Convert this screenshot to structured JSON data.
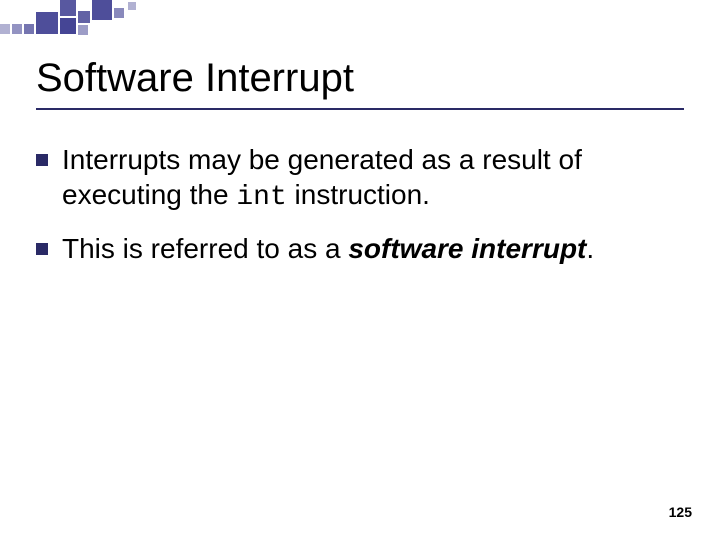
{
  "title": "Software Interrupt",
  "bullets": [
    {
      "pre": "Interrupts may be generated as a result of executing the ",
      "code": "int",
      "post": " instruction."
    },
    {
      "pre": "This is referred to as a ",
      "term": "software interrupt",
      "post": "."
    }
  ],
  "page_number": "125"
}
